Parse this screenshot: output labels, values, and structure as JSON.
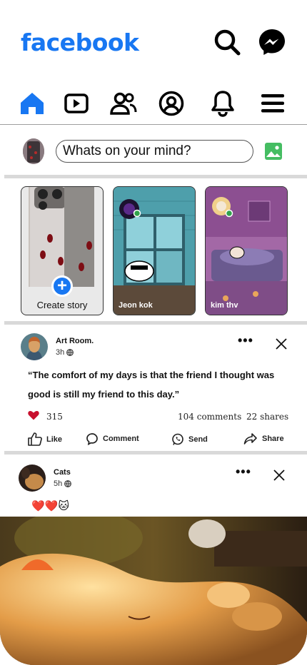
{
  "header": {
    "logo_text": "facebook",
    "brand_color": "#1877f2",
    "icons": [
      "search-icon",
      "messenger-icon"
    ]
  },
  "nav": {
    "items": [
      "home-icon",
      "video-icon",
      "friends-icon",
      "profile-icon",
      "notifications-icon",
      "menu-icon"
    ],
    "active": "home-icon"
  },
  "composer": {
    "placeholder": "Whats on your mind?",
    "photo_icon": "photo-icon",
    "photo_color": "#45bd62"
  },
  "stories": [
    {
      "label": "Create story",
      "type": "create"
    },
    {
      "label": "Jeon kok",
      "type": "story"
    },
    {
      "label": "kim thv",
      "type": "story"
    }
  ],
  "posts": [
    {
      "author": "Art Room.",
      "time": "3h",
      "text": "“The comfort of my days is that the friend I thought was good is still my friend to this day.”",
      "likes": "315",
      "comments": "104 comments",
      "shares": "22 shares",
      "actions": [
        "Like",
        "Comment",
        "Send",
        "Share"
      ]
    },
    {
      "author": "Cats",
      "time": "5h",
      "text": "❤️❤️🐱"
    }
  ]
}
